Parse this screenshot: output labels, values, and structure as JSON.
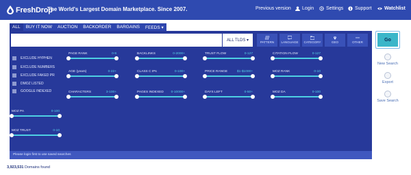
{
  "header": {
    "logo": "FreshDrop",
    "tagline": "The World's Largest Domain Marketplace. Since 2007.",
    "nav": [
      {
        "label": "Previous version",
        "icon": ""
      },
      {
        "label": "Login",
        "icon": "user-icon"
      },
      {
        "label": "Settings",
        "icon": "gear-icon"
      },
      {
        "label": "Support",
        "icon": "info-icon"
      },
      {
        "label": "Watchlist",
        "icon": "eye-icon"
      }
    ]
  },
  "tabs": [
    "ALL",
    "BUY IT NOW",
    "AUCTION",
    "BACKORDER",
    "BARGAINS",
    "FEEDS ▾"
  ],
  "search": {
    "value": "",
    "tld_label": "ALL TLDS ▾",
    "filters": [
      "PATTERN",
      "LANGUAGE",
      "CATEGORY",
      "GEO",
      "OTHER"
    ]
  },
  "go_label": "Go",
  "side_actions": [
    "New Search",
    "Export",
    "Save Search"
  ],
  "checkboxes": [
    "EXCLUDE HYPHEN",
    "EXCLUDE NUMBERS",
    "EXCLUDE FAKED PR",
    "DMOZ LISTED",
    "GOOGLE INDEXED"
  ],
  "sliders": [
    {
      "label": "PAGE RANK",
      "range": "0-9"
    },
    {
      "label": "BACKLINKS",
      "range": "0-2000+"
    },
    {
      "label": "TRUST FLOW",
      "range": "0-127"
    },
    {
      "label": "CITATION FLOW",
      "range": "0-127"
    },
    {
      "label": "AGE (years)",
      "range": "0-22+"
    },
    {
      "label": "CLASS C IPs",
      "range": "0-100+"
    },
    {
      "label": "PRICE RANGE",
      "range": "$1-$1000+"
    },
    {
      "label": "MOZ RANK",
      "range": "0-10"
    },
    {
      "label": "CHARACTERS",
      "range": "3-100+"
    },
    {
      "label": "PAGES INDEXED",
      "range": "0-10000+"
    },
    {
      "label": "DAYS LEFT",
      "range": "0-50+"
    },
    {
      "label": "MOZ DA",
      "range": "0-100"
    },
    {
      "label": "MOZ PA",
      "range": "0-100"
    },
    {
      "label": "MOZ TRUST",
      "range": "0-10"
    }
  ],
  "login_note": "Please login first to use saved searches",
  "results": {
    "count": "3,923,531",
    "suffix": "Domains found"
  }
}
